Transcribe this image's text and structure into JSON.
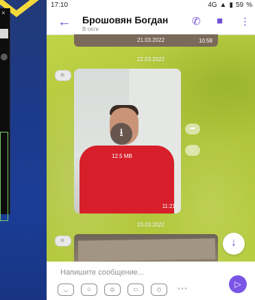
{
  "status": {
    "time": "17:10",
    "network": "4G",
    "battery_text": "59"
  },
  "chat": {
    "name": "Брошовян Богдан",
    "presence": "В сети"
  },
  "messages": {
    "prev_date": "21.03.2022",
    "prev_time": "10:58",
    "date_1": "22.03.2022",
    "video_size": "12.5 MB",
    "video_time": "11:21",
    "date_2": "23.03.2022"
  },
  "composer": {
    "placeholder": "Напишите сообщение..."
  },
  "colors": {
    "accent": "#7b55e6",
    "wallpaper": "#b9cf3f"
  },
  "icons": [
    "back-arrow-icon",
    "call-icon",
    "video-call-icon",
    "more-icon",
    "download-icon",
    "share-icon",
    "like-icon",
    "scroll-down-icon",
    "sticker-icon",
    "emoji-icon",
    "camera-icon",
    "gif-icon",
    "timer-icon",
    "more-options-icon",
    "send-icon"
  ]
}
